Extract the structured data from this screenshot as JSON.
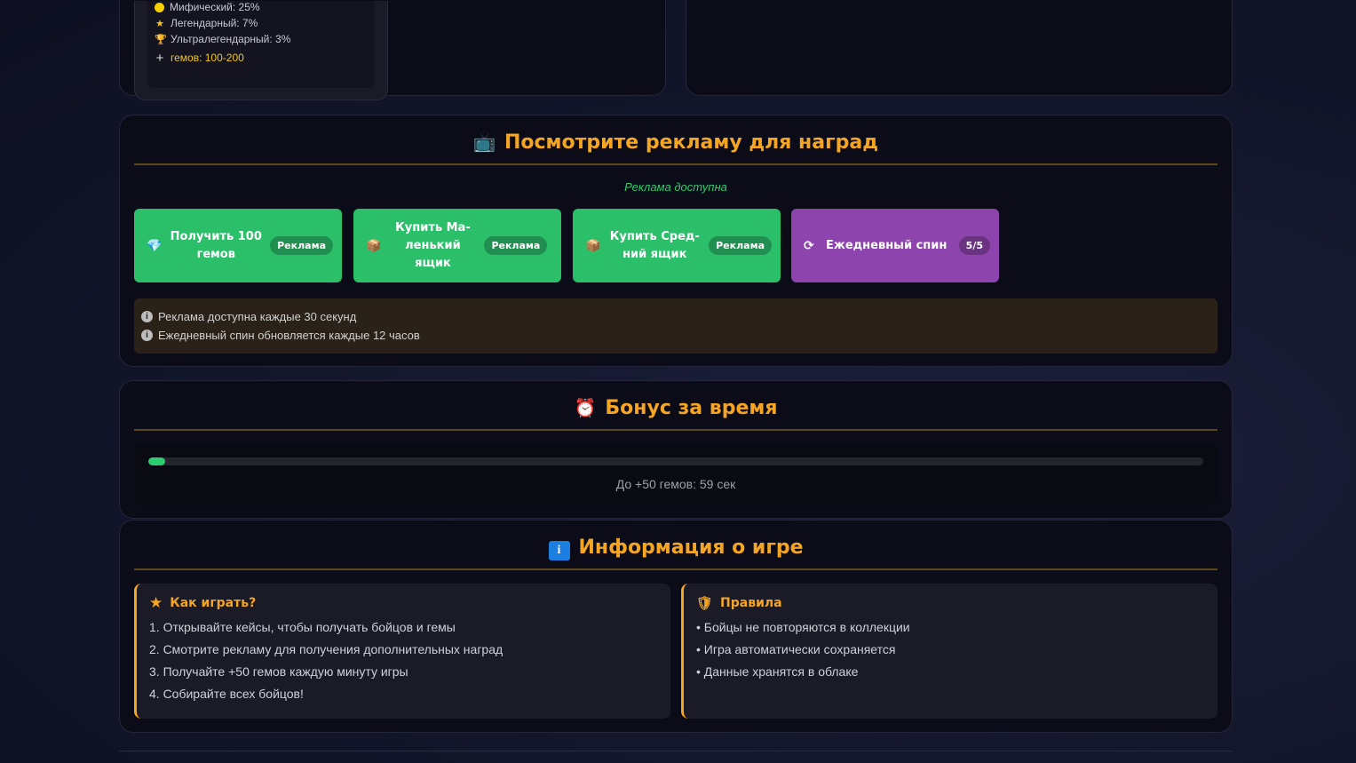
{
  "rarities": [
    {
      "label": "Мифический: 25%",
      "icon": "yellow-dot-icon"
    },
    {
      "label": "Легендарный: 7%",
      "icon": "star-icon"
    },
    {
      "label": "Ультралегендарный: 3%",
      "icon": "trophy-icon"
    },
    {
      "label": "гемов: 100-200",
      "icon": "plus-icon"
    }
  ],
  "ads": {
    "title": "Посмотрите рекламу для наград",
    "title_emoji": "📺",
    "status": "Реклама доступна",
    "buttons": [
      {
        "label": "Получить 100 гемов",
        "badge": "Реклама",
        "icon": "gem-icon"
      },
      {
        "label": "Купить Ма-леньkий ящик",
        "badge": "Реклама",
        "icon": "box-icon"
      },
      {
        "label": "Купить Сред-ний ящик",
        "badge": "Реклама",
        "icon": "box-icon"
      },
      {
        "label": "Ежедневный спин",
        "badge": "5/5",
        "icon": "refresh-icon"
      }
    ],
    "notes": [
      "Реклама доступна каждые 30 секунд",
      "Ежедневный спин обновляется каждые 12 часов"
    ]
  },
  "bonus": {
    "title": "Бонус за время",
    "title_emoji": "⏰",
    "progress": 0.016,
    "text": "До +50 гемов: 59 сек"
  },
  "info": {
    "title": "Информация о игре",
    "title_icon": "i",
    "how_title": "Как играть?",
    "how_items": [
      "1. Открывайте кейсы, чтобы получать бойцов и гемы",
      "2. Смотрите рекламу для получения дополнительных наград",
      "3. Получайте +50 гемов каждую минуту игры",
      "4. Собирайте всех бойцов!"
    ],
    "rules_title": "Правила",
    "rules_items": [
      "• Бойцы не повторяются в коллекции",
      "• Игра автоматически сохраняется",
      "• Данные хранятся в облаке"
    ]
  },
  "colors": {
    "accent": "#f5a524",
    "green": "#2bbf6a",
    "purple": "#8e44ad",
    "panel": "#0b0c17"
  }
}
